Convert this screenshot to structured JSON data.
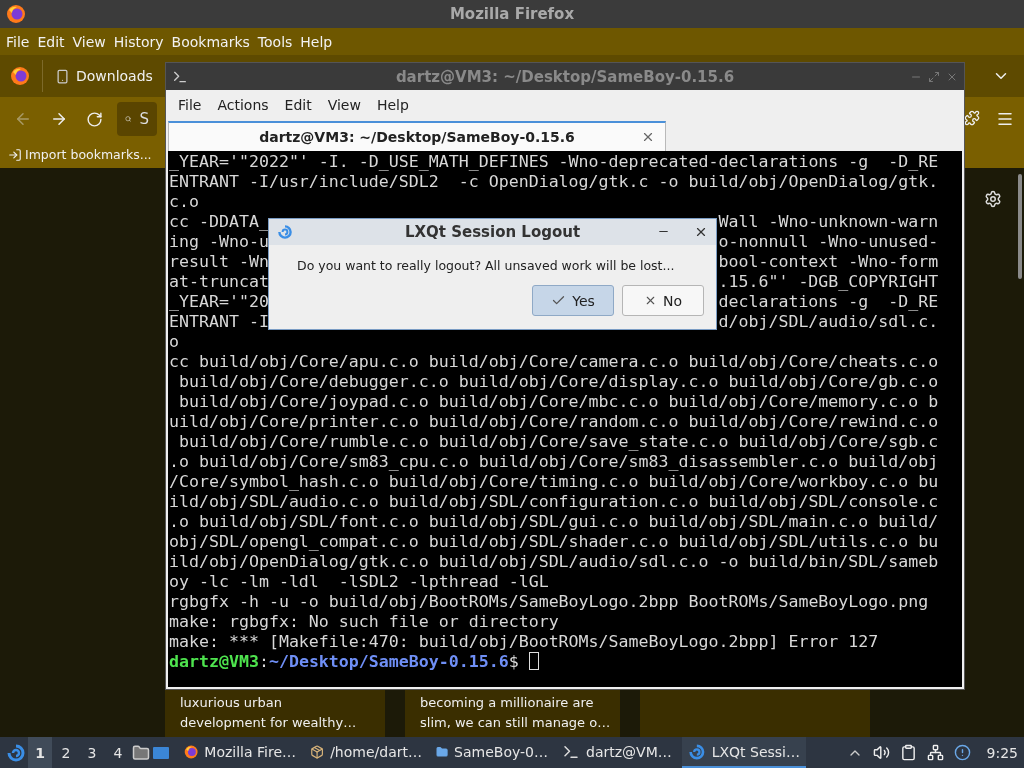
{
  "firefox": {
    "title": "Mozilla Firefox",
    "menu": [
      "File",
      "Edit",
      "View",
      "History",
      "Bookmarks",
      "Tools",
      "Help"
    ],
    "tab": {
      "label": "Downloads"
    },
    "search": {
      "placeholder": "S"
    },
    "bookmarks": [
      "Import bookmarks..."
    ],
    "cards": [
      {
        "kind": "text",
        "lines": [
          "luxurious urban",
          "development for wealthy…"
        ]
      },
      {
        "kind": "text",
        "lines": [
          "becoming a millionaire are",
          "slim, we can still manage o…"
        ]
      },
      {
        "kind": "blank"
      }
    ]
  },
  "terminal": {
    "title": "dartz@VM3: ~/Desktop/SameBoy-0.15.6",
    "menu": [
      "File",
      "Actions",
      "Edit",
      "View",
      "Help"
    ],
    "tabs": [
      {
        "label": "dartz@VM3: ~/Desktop/SameBoy-0.15.6",
        "selected": true
      }
    ],
    "lines": [
      {
        "text": "_YEAR='\"2022\"' -I. -D_USE_MATH_DEFINES -Wno-deprecated-declarations -g  -D_RE"
      },
      {
        "text": "ENTRANT -I/usr/include/SDL2  -c OpenDialog/gtk.c -o build/obj/OpenDialog/gtk."
      },
      {
        "text": "c.o"
      },
      {
        "left": "cc -DDATA_",
        "right": "Wall -Wno-unknown-warn"
      },
      {
        "left": "ing -Wno-u",
        "right": "o-nonnull -Wno-unused-"
      },
      {
        "left": "result -Wn",
        "right": "bool-context -Wno-form"
      },
      {
        "left": "at-truncat",
        "right": ".15.6\"' -DGB_COPYRIGHT"
      },
      {
        "left": "_YEAR='\"20",
        "right": "declarations -g  -D_RE"
      },
      {
        "left": "ENTRANT -I",
        "right": "d/obj/SDL/audio/sdl.c."
      },
      {
        "text": "o"
      },
      {
        "text": "cc build/obj/Core/apu.c.o build/obj/Core/camera.c.o build/obj/Core/cheats.c.o"
      },
      {
        "text": " build/obj/Core/debugger.c.o build/obj/Core/display.c.o build/obj/Core/gb.c.o"
      },
      {
        "text": " build/obj/Core/joypad.c.o build/obj/Core/mbc.c.o build/obj/Core/memory.c.o b"
      },
      {
        "text": "uild/obj/Core/printer.c.o build/obj/Core/random.c.o build/obj/Core/rewind.c.o"
      },
      {
        "text": " build/obj/Core/rumble.c.o build/obj/Core/save_state.c.o build/obj/Core/sgb.c"
      },
      {
        "text": ".o build/obj/Core/sm83_cpu.c.o build/obj/Core/sm83_disassembler.c.o build/obj"
      },
      {
        "text": "/Core/symbol_hash.c.o build/obj/Core/timing.c.o build/obj/Core/workboy.c.o bu"
      },
      {
        "text": "ild/obj/SDL/audio.c.o build/obj/SDL/configuration.c.o build/obj/SDL/console.c"
      },
      {
        "text": ".o build/obj/SDL/font.c.o build/obj/SDL/gui.c.o build/obj/SDL/main.c.o build/"
      },
      {
        "text": "obj/SDL/opengl_compat.c.o build/obj/SDL/shader.c.o build/obj/SDL/utils.c.o bu"
      },
      {
        "text": "ild/obj/OpenDialog/gtk.c.o build/obj/SDL/audio/sdl.c.o -o build/bin/SDL/sameb"
      },
      {
        "text": "oy -lc -lm -ldl  -lSDL2 -lpthread -lGL"
      },
      {
        "text": "rgbgfx -h -u -o build/obj/BootROMs/SameBoyLogo.2bpp BootROMs/SameBoyLogo.png"
      },
      {
        "text": "make: rgbgfx: No such file or directory"
      },
      {
        "text": "make: *** [Makefile:470: build/obj/BootROMs/SameBoyLogo.2bpp] Error 127"
      }
    ],
    "prompt": {
      "user": "dartz@VM3",
      "separator": ":",
      "path": "~/Desktop/SameBoy-0.15.6",
      "symbol": "$"
    }
  },
  "dialog": {
    "title": "LXQt Session Logout",
    "message": "Do you want to really logout? All unsaved work will be lost...",
    "buttons": [
      {
        "label": "Yes",
        "kind": "yes",
        "selected": true
      },
      {
        "label": "No",
        "kind": "no",
        "selected": false
      }
    ]
  },
  "taskbar": {
    "desktops": [
      {
        "label": "1",
        "selected": true
      },
      {
        "label": "2",
        "selected": false
      },
      {
        "label": "3",
        "selected": false
      },
      {
        "label": "4",
        "selected": false
      }
    ],
    "tasks": [
      {
        "label": "Mozilla Fire…",
        "kind": "firefox",
        "selected": false
      },
      {
        "label": "/home/dart…",
        "kind": "package",
        "selected": false
      },
      {
        "label": "SameBoy-0…",
        "kind": "folder",
        "selected": false
      },
      {
        "label": "dartz@VM…",
        "kind": "terminal",
        "selected": false
      },
      {
        "label": "LXQt Sessi…",
        "kind": "logout",
        "selected": true
      }
    ],
    "clock": "9:25"
  }
}
